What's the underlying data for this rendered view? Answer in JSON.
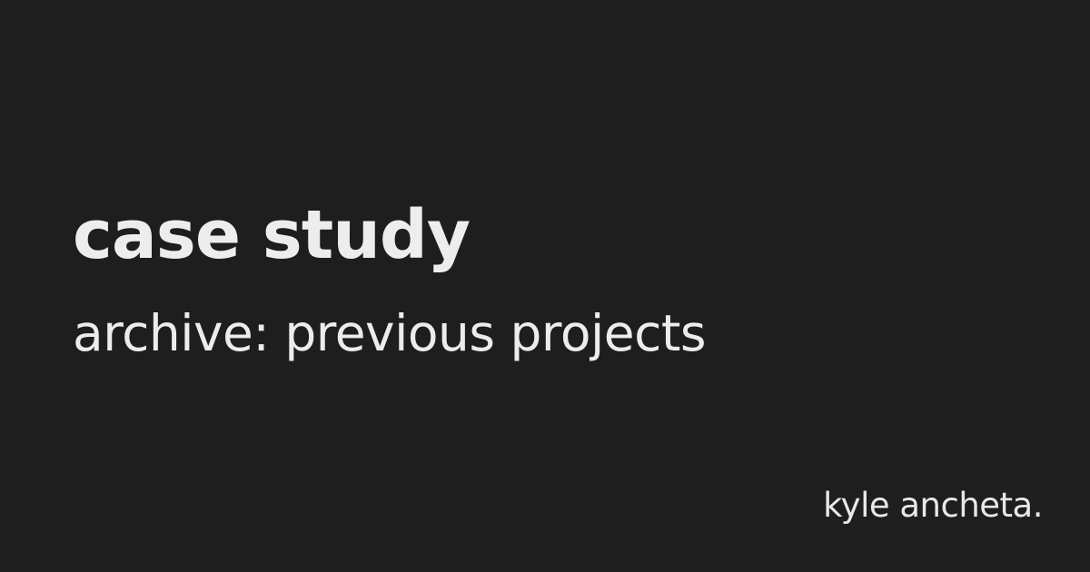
{
  "card": {
    "title": "case study",
    "subtitle": "archive: previous projects",
    "author": "kyle ancheta.",
    "colors": {
      "background": "#1e1e1e",
      "text": "#ededed"
    }
  }
}
